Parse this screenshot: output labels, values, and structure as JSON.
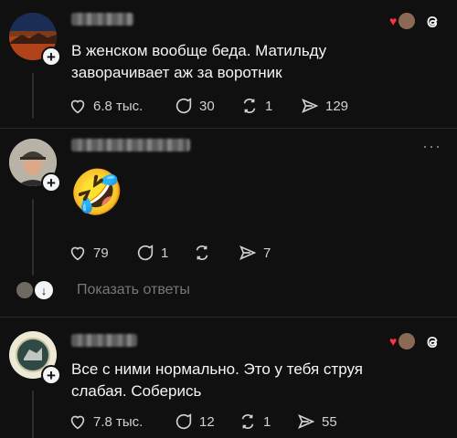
{
  "posts": [
    {
      "text": "В женском вообще беда. Матильду заворачивает аж за воротник",
      "likes": "6.8 тыс.",
      "comments": "30",
      "reposts": "1",
      "shares": "129"
    },
    {
      "emoji": "🤣",
      "likes": "79",
      "comments": "1",
      "reposts": "",
      "shares": "7"
    },
    {
      "text": "Все с ними нормально.  Это у тебя струя слабая. Соберись",
      "likes": "7.8 тыс.",
      "comments": "12",
      "reposts": "1",
      "shares": "55"
    }
  ],
  "show_replies_label": "Показать ответы",
  "colors": {
    "background": "#101010",
    "text": "#f3f5f7",
    "muted": "#777777",
    "heart_red": "#ff3040"
  }
}
